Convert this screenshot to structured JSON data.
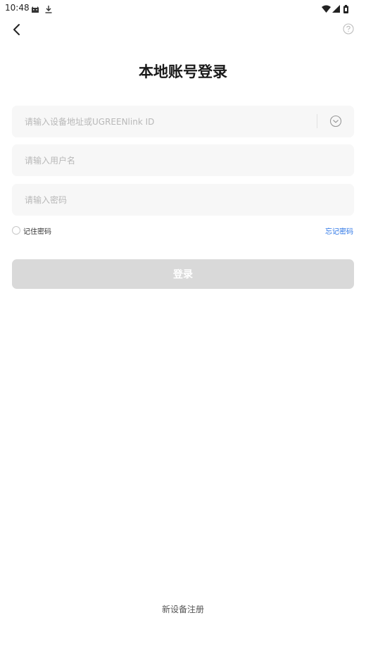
{
  "status_bar": {
    "time": "10:48",
    "left_icons": [
      "cat-icon",
      "download-icon"
    ],
    "right_icons": [
      "wifi-icon",
      "signal-icon",
      "battery-icon"
    ]
  },
  "header": {
    "back_icon": "chevron-left-icon",
    "help_icon": "question-circle-icon",
    "title": "本地账号登录"
  },
  "form": {
    "address_placeholder": "请输入设备地址或UGREENlink ID",
    "address_value": "",
    "username_placeholder": "请输入用户名",
    "username_value": "",
    "password_placeholder": "请输入密码",
    "password_value": "",
    "remember_label": "记住密码",
    "remember_checked": false,
    "forgot_label": "忘记密码",
    "login_label": "登录"
  },
  "footer": {
    "register_label": "新设备注册"
  },
  "colors": {
    "link": "#2a74e6",
    "button_disabled": "#d9d9d9",
    "field_bg": "#f7f7f7"
  }
}
